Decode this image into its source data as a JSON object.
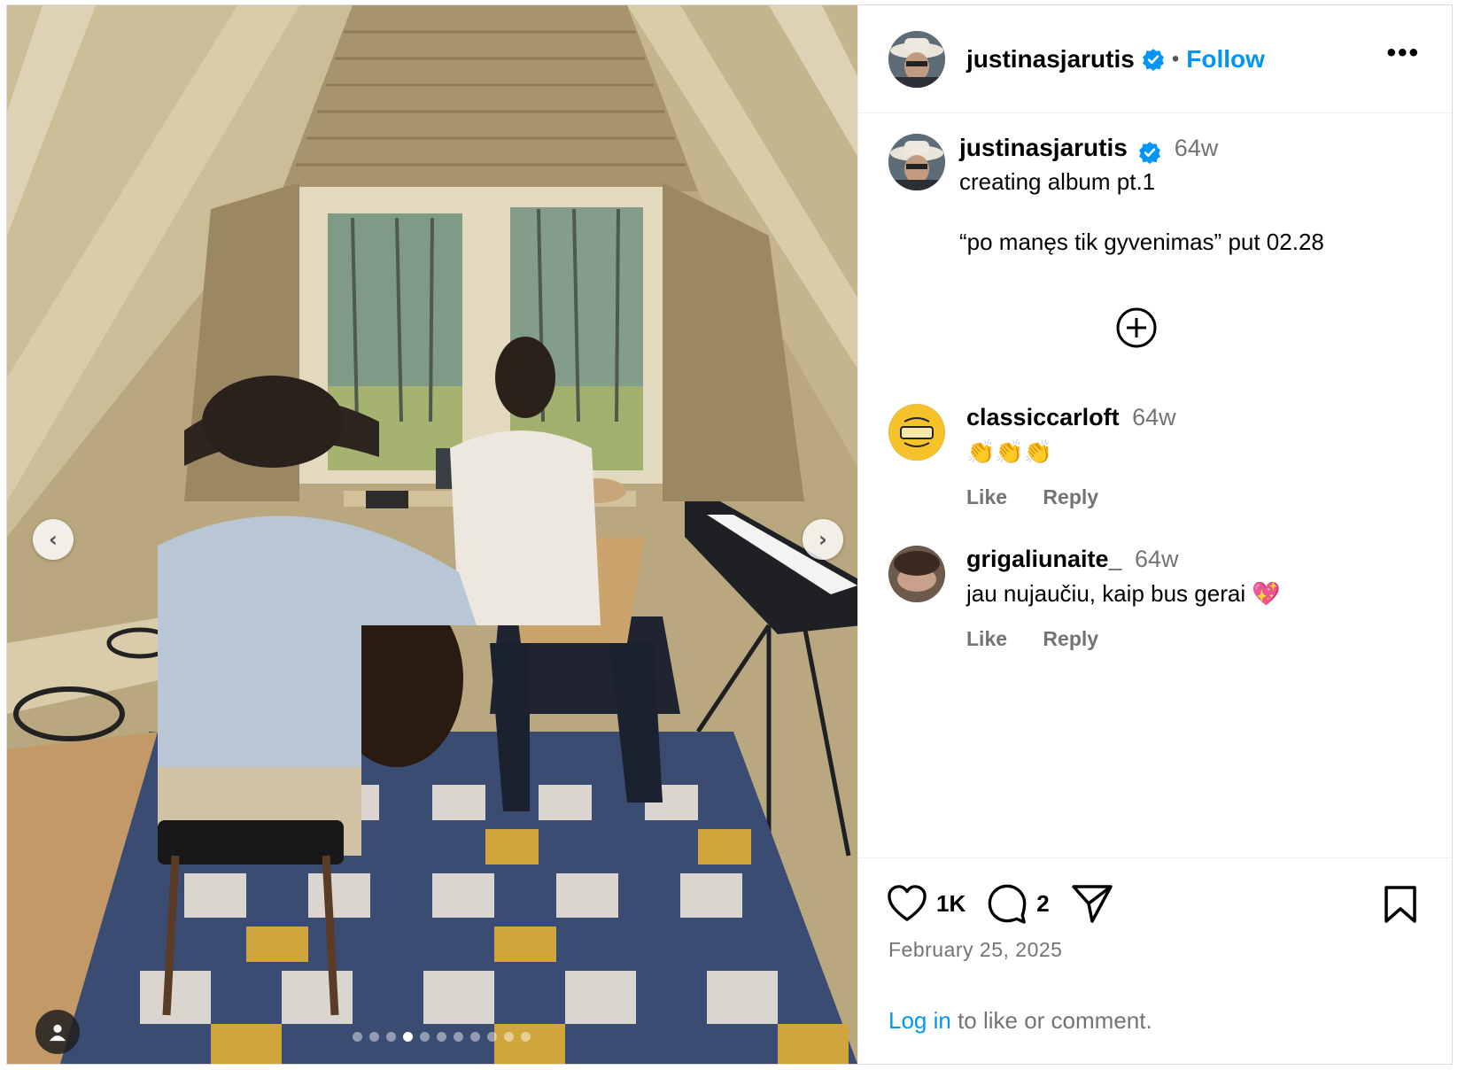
{
  "post": {
    "author": "justinasjarutis",
    "follow_label": "Follow",
    "separator": "•",
    "more_label": "•••",
    "caption_time": "64w",
    "caption_line1": "creating album pt.1",
    "caption_line2": "“po manęs tik gyvenimas” put 02.28"
  },
  "media": {
    "slide_count": 11,
    "active_slide": 4,
    "prev_label": "‹",
    "next_label": "›"
  },
  "comments": [
    {
      "username": "classiccarloft",
      "time": "64w",
      "text": "👏👏👏",
      "like": "Like",
      "reply": "Reply"
    },
    {
      "username": "grigaliunaite_",
      "time": "64w",
      "text": "jau nujaučiu, kaip bus gerai 💖",
      "like": "Like",
      "reply": "Reply"
    }
  ],
  "footer": {
    "likes": "1K",
    "comments": "2",
    "date": "February 25, 2025",
    "login_link": "Log in",
    "login_rest": " to like or comment."
  },
  "colors": {
    "link_blue": "#0095f6",
    "secondary_text": "#737373",
    "border": "#dbdbdb"
  }
}
